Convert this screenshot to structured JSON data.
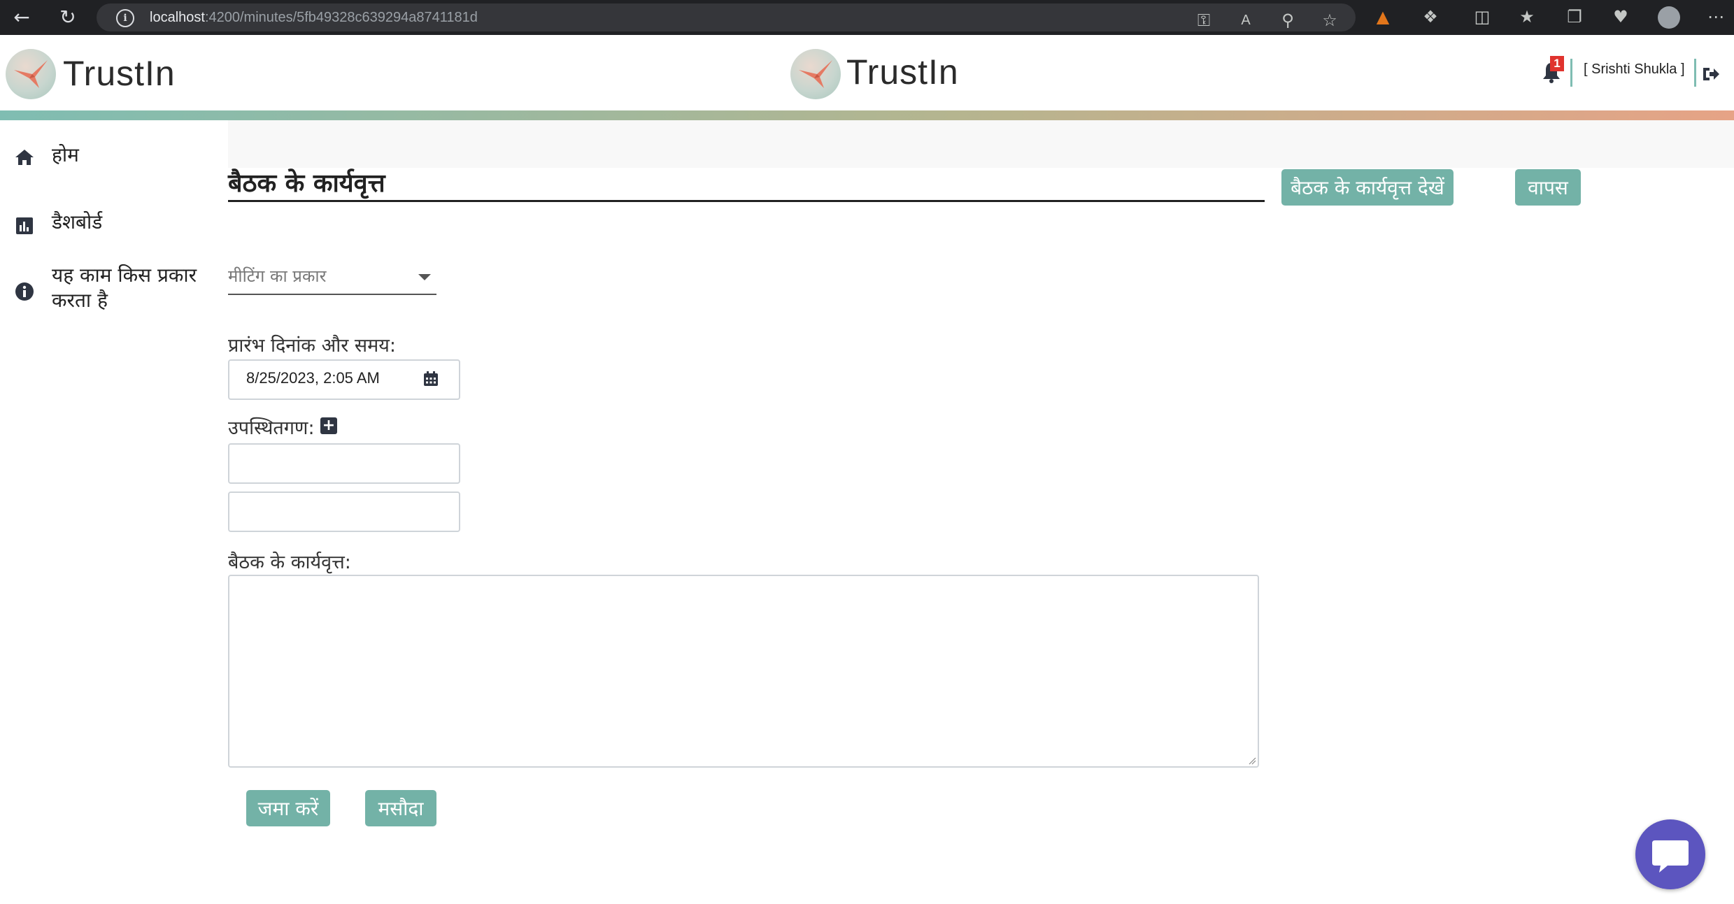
{
  "browser": {
    "url_host": "localhost",
    "url_path": ":4200/minutes/5fb49328c639294a8741181d"
  },
  "header": {
    "brand_left": "TrustIn",
    "brand_center": "TrustIn",
    "notification_count": "1",
    "user_name": "[ Srishti Shukla ]"
  },
  "sidebar": {
    "items": [
      {
        "label": "होम",
        "icon": "home-icon"
      },
      {
        "label": "डैशबोर्ड",
        "icon": "chart-icon"
      },
      {
        "label": "यह काम किस प्रकार करता है",
        "icon": "info-icon"
      }
    ]
  },
  "main": {
    "title": "बैठक के कार्यवृत्त",
    "view_minutes_button": "बैठक के कार्यवृत्त देखें",
    "back_button": "वापस",
    "meeting_type_placeholder": "मीटिंग का प्रकार",
    "start_label": "प्रारंभ दिनांक और समय:",
    "start_value": "8/25/2023, 2:05 AM",
    "attendees_label": "उपस्थितगण:",
    "minutes_label": "बैठक के कार्यवृत्त:",
    "submit_button": "जमा करें",
    "draft_button": "मसौदा"
  },
  "colors": {
    "accent": "#73b2a7",
    "chat_button": "#5c55bf",
    "badge": "#e0332e"
  }
}
